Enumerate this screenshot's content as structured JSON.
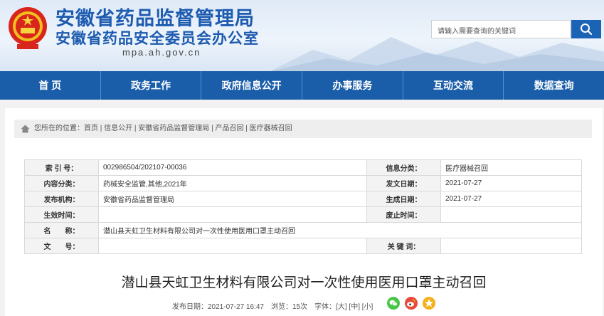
{
  "header": {
    "title1": "安徽省药品监督管理局",
    "title2": "安徽省药品安全委员会办公室",
    "domain": "mpa.ah.gov.cn",
    "search_placeholder": "请输入需要查询的关键词"
  },
  "nav": [
    "首 页",
    "政务工作",
    "政府信息公开",
    "办事服务",
    "互动交流",
    "数据查询"
  ],
  "breadcrumb": "您所在的位置：首页 | 信息公开 | 安徽省药品监督管理局 | 产品召回 | 医疗器械召回",
  "meta": {
    "rows": [
      {
        "l1": "索 引 号：",
        "v1": "002986504/202107-00036",
        "l2": "信息分类：",
        "v2": "医疗器械召回"
      },
      {
        "l1": "内容分类：",
        "v1": "药械安全监管,其他,2021年",
        "l2": "发文日期：",
        "v2": "2021-07-27"
      },
      {
        "l1": "发布机构：",
        "v1": "安徽省药品监督管理局",
        "l2": "生成日期：",
        "v2": "2021-07-27"
      },
      {
        "l1": "生效时间：",
        "v1": "",
        "l2": "废止时间：",
        "v2": ""
      }
    ],
    "name_label": "名　　称：",
    "name_value": "潜山县天虹卫生材料有限公司对一次性使用医用口罩主动召回",
    "doc_label": "文　　号：",
    "doc_value": "",
    "keyword_label": "关 键 词：",
    "keyword_value": ""
  },
  "article": {
    "title": "潜山县天虹卫生材料有限公司对一次性使用医用口罩主动召回",
    "pubinfo": "发布日期：2021-07-27 16:47　浏览：15次　字体：[大] [中] [小]"
  },
  "colors": {
    "nav": "#1a5da8",
    "title": "#1d5bb0",
    "wechat": "#4ac74a",
    "weibo": "#e84a3a",
    "qzone": "#f5b01a"
  }
}
